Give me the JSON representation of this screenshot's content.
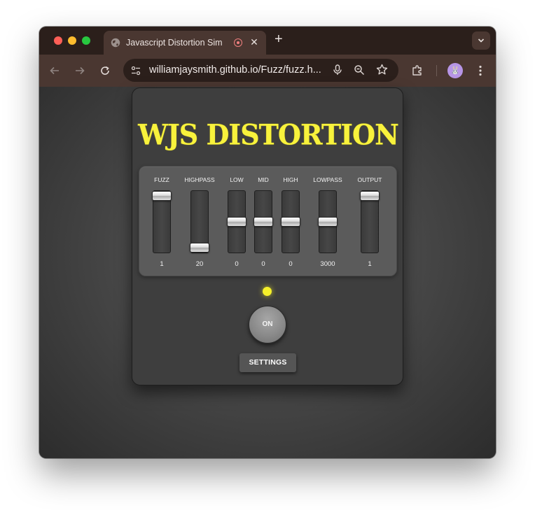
{
  "browser": {
    "tab_title": "Javascript Distortion Sim",
    "tab_close": "✕",
    "new_tab": "+",
    "tab_menu": "⌄",
    "url": "williamjaysmith.github.io/Fuzz/fuzz.h...",
    "avatar_text": "🐰"
  },
  "pedal": {
    "title": "WJS DISTORTION",
    "accent_color": "#f8f23c",
    "led_color": "#f5f02a",
    "sliders": [
      {
        "label": "FUZZ",
        "value": "1",
        "fraction": 1.0
      },
      {
        "label": "HIGHPASS",
        "value": "20",
        "fraction": 0.0
      },
      {
        "label": "LOW",
        "value": "0",
        "fraction": 0.5
      },
      {
        "label": "MID",
        "value": "0",
        "fraction": 0.5
      },
      {
        "label": "HIGH",
        "value": "0",
        "fraction": 0.5
      },
      {
        "label": "LOWPASS",
        "value": "3000",
        "fraction": 0.5
      },
      {
        "label": "OUTPUT",
        "value": "1",
        "fraction": 1.0
      }
    ],
    "on_label": "ON",
    "settings_label": "SETTINGS"
  }
}
